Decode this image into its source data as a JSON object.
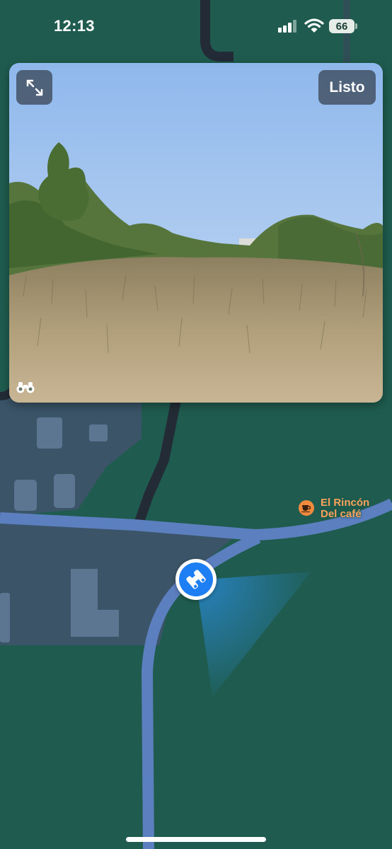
{
  "status_bar": {
    "time": "12:13",
    "battery_level": "66",
    "icons": [
      "signal-icon",
      "wifi-icon",
      "battery-icon"
    ]
  },
  "look_around": {
    "expand_icon": "expand-arrows-icon",
    "done_label": "Listo",
    "mode_icon": "binoculars-icon"
  },
  "poi": {
    "name_line1": "El Rincón",
    "name_line2": "Del café",
    "icon": "coffee-cup-icon",
    "color": "#f08a3c"
  },
  "user_location": {
    "icon": "binoculars-icon",
    "color": "#1e7ef3"
  },
  "colors": {
    "map_background": "#1f5c4f",
    "road": "#5c7fc0",
    "buildings_area": "#3b5468",
    "accent_blue": "#1e7ef3"
  }
}
